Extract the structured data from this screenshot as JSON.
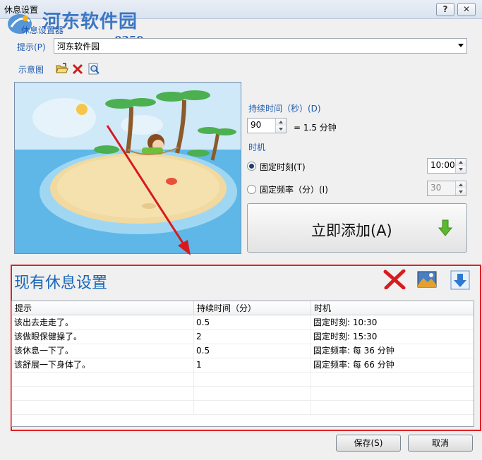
{
  "window": {
    "title": "休息设置",
    "help_label": "?",
    "close_label": "✕"
  },
  "watermark": {
    "name": "河东软件园",
    "url": "www.pc0359.cn"
  },
  "group": {
    "title": "休息设置器"
  },
  "prompt": {
    "label": "提示(P)",
    "value": "河东软件园"
  },
  "preview": {
    "label": "示意图",
    "icons": [
      "open-folder-icon",
      "delete-x-icon",
      "zoom-preview-icon"
    ]
  },
  "duration": {
    "label": "持续时间（秒）(D)",
    "value": "90",
    "equals_text": "= 1.5 分钟"
  },
  "timing": {
    "label": "时机",
    "fixed_time": {
      "label": "固定时刻(T)",
      "value": "10:00",
      "selected": true
    },
    "fixed_freq": {
      "label": "固定频率（分）(I)",
      "value": "30",
      "selected": false
    }
  },
  "add_button": {
    "label": "立即添加(A)",
    "icon": "green-down-arrow-icon"
  },
  "existing": {
    "title": "现有休息设置",
    "toolbar_icons": [
      "red-delete-icon",
      "picture-icon",
      "download-arrow-icon"
    ],
    "columns": [
      "提示",
      "持续时间（分）",
      "时机"
    ],
    "rows": [
      [
        "该出去走走了。",
        "0.5",
        "固定时刻: 10:30"
      ],
      [
        "该做眼保健操了。",
        "2",
        "固定时刻: 15:30"
      ],
      [
        "该休息一下了。",
        "0.5",
        "固定频率: 每 36 分钟"
      ],
      [
        "该舒展一下身体了。",
        "1",
        "固定频率: 每 66 分钟"
      ]
    ]
  },
  "footer": {
    "save_label": "保存(S)",
    "cancel_label": "取消"
  },
  "colors": {
    "accent_blue": "#1967b8",
    "highlight_red": "#e21f26",
    "green_arrow": "#5cb82e"
  }
}
